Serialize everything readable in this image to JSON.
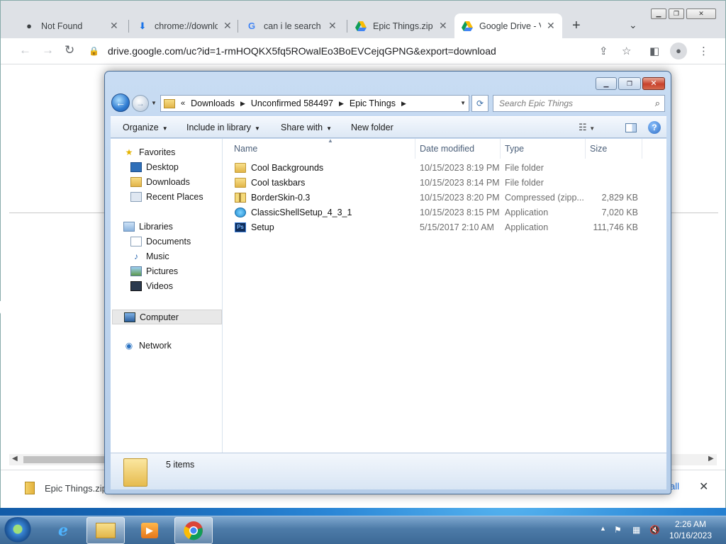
{
  "browser": {
    "tabs": [
      {
        "title": "Not Found",
        "icon": "github-icon"
      },
      {
        "title": "chrome://downlo",
        "icon": "download-icon"
      },
      {
        "title": "can i le search - G",
        "icon": "google-icon"
      },
      {
        "title": "Epic Things.zip - ",
        "icon": "drive-icon"
      },
      {
        "title": "Google Drive - V",
        "icon": "drive-icon"
      }
    ],
    "active_tab_index": 4,
    "url": "drive.google.com/uc?id=1-rmHOQKX5fq5ROwalEo3BoEVCejqGPNG&export=download",
    "download": {
      "file": "Epic Things.zip",
      "show_all": "all"
    }
  },
  "explorer": {
    "breadcrumb": [
      "Downloads",
      "Unconfirmed 584497",
      "Epic Things"
    ],
    "search_placeholder": "Search Epic Things",
    "commands": {
      "organize": "Organize",
      "include": "Include in library",
      "share": "Share with",
      "new_folder": "New folder"
    },
    "nav": {
      "favorites": "Favorites",
      "favorites_items": [
        "Desktop",
        "Downloads",
        "Recent Places"
      ],
      "libraries": "Libraries",
      "libraries_items": [
        "Documents",
        "Music",
        "Pictures",
        "Videos"
      ],
      "computer": "Computer",
      "network": "Network"
    },
    "columns": {
      "name": "Name",
      "date": "Date modified",
      "type": "Type",
      "size": "Size"
    },
    "files": [
      {
        "name": "Cool Backgrounds",
        "date": "10/15/2023 8:19 PM",
        "type": "File folder",
        "size": "",
        "icon": "folder-icon"
      },
      {
        "name": "Cool taskbars",
        "date": "10/15/2023 8:14 PM",
        "type": "File folder",
        "size": "",
        "icon": "folder-icon"
      },
      {
        "name": "BorderSkin-0.3",
        "date": "10/15/2023 8:20 PM",
        "type": "Compressed (zipp...",
        "size": "2,829 KB",
        "icon": "zip-icon"
      },
      {
        "name": "ClassicShellSetup_4_3_1",
        "date": "10/15/2023 8:15 PM",
        "type": "Application",
        "size": "7,020 KB",
        "icon": "classic-shell-icon"
      },
      {
        "name": "Setup",
        "date": "5/15/2017 2:10 AM",
        "type": "Application",
        "size": "111,746 KB",
        "icon": "photoshop-icon"
      }
    ],
    "status": "5 items"
  },
  "taskbar": {
    "clock_time": "2:26 AM",
    "clock_date": "10/16/2023",
    "pinned": [
      "internet-explorer-icon",
      "explorer-icon",
      "media-player-icon",
      "chrome-icon"
    ]
  }
}
